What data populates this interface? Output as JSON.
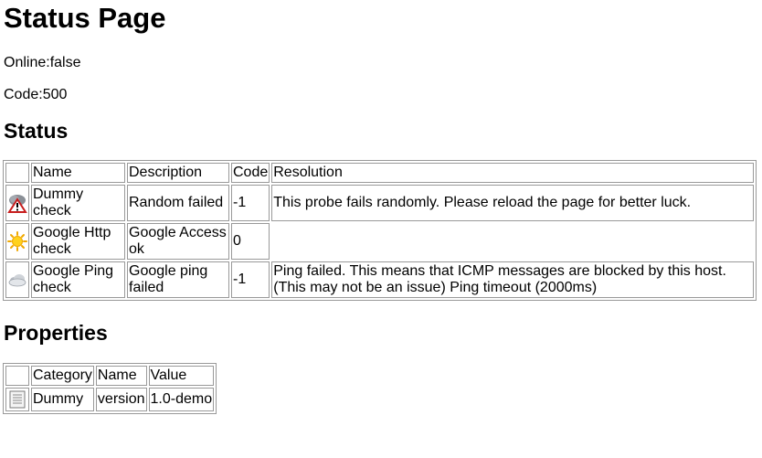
{
  "page": {
    "title": "Status Page",
    "online_line": "Online:false",
    "code_line": "Code:500"
  },
  "status_section": {
    "heading": "Status",
    "headers": [
      "Name",
      "Description",
      "Code",
      "Resolution"
    ],
    "rows": [
      {
        "icon": "storm-warning-icon",
        "name": "Dummy check",
        "description": "Random failed",
        "code": "-1",
        "resolution": "This probe fails randomly. Please reload the page for better luck."
      },
      {
        "icon": "sun-icon",
        "name": "Google Http check",
        "description": "Google Access ok",
        "code": "0",
        "resolution": ""
      },
      {
        "icon": "cloud-icon",
        "name": "Google Ping check",
        "description": "Google ping failed",
        "code": "-1",
        "resolution": "Ping failed. This means that ICMP messages are blocked by this host. (This may not be an issue) Ping timeout (2000ms)"
      }
    ]
  },
  "properties_section": {
    "heading": "Properties",
    "headers": [
      "Category",
      "Name",
      "Value"
    ],
    "rows": [
      {
        "icon": "document-icon",
        "category": "Dummy",
        "name": "version",
        "value": "1.0-demo"
      }
    ]
  }
}
